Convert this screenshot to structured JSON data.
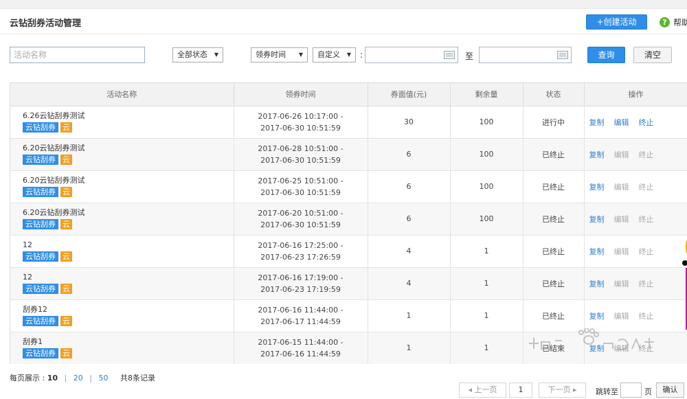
{
  "header": {
    "title": "云钻刮券活动管理",
    "create_label": "+创建活动",
    "help_label": "帮助"
  },
  "filters": {
    "name_placeholder": "活动名称",
    "status_select": "全部状态",
    "time_type_select": "领券时间",
    "range_select": "自定义",
    "colon": ":",
    "to_label": "至",
    "query_label": "查询",
    "clear_label": "清空"
  },
  "table": {
    "columns": [
      "活动名称",
      "领券时间",
      "券面值(元)",
      "剩余量",
      "状态",
      "操作"
    ],
    "tag_primary": "云钻刮券",
    "tag_secondary": "云",
    "rows": [
      {
        "name": "6.26云钻刮券测试",
        "start": "2017-06-26 10:17:00 -",
        "end": "2017-06-30 10:51:59",
        "value": "30",
        "remaining": "100",
        "status": "进行中",
        "ops": [
          "复制",
          "编辑",
          "终止"
        ],
        "ops_enabled": [
          true,
          true,
          true
        ]
      },
      {
        "name": "6.20云钻刮券测试",
        "start": "2017-06-28 10:51:00 -",
        "end": "2017-06-30 10:51:59",
        "value": "6",
        "remaining": "100",
        "status": "已终止",
        "ops": [
          "复制",
          "编辑",
          "终止"
        ],
        "ops_enabled": [
          true,
          false,
          false
        ]
      },
      {
        "name": "6.20云钻刮券测试",
        "start": "2017-06-25 10:51:00 -",
        "end": "2017-06-30 10:51:59",
        "value": "6",
        "remaining": "100",
        "status": "已终止",
        "ops": [
          "复制",
          "编辑",
          "终止"
        ],
        "ops_enabled": [
          true,
          false,
          false
        ]
      },
      {
        "name": "6.20云钻刮券测试",
        "start": "2017-06-20 10:51:00 -",
        "end": "2017-06-30 10:51:59",
        "value": "6",
        "remaining": "100",
        "status": "已终止",
        "ops": [
          "复制",
          "编辑",
          "终止"
        ],
        "ops_enabled": [
          true,
          false,
          false
        ]
      },
      {
        "name": "12",
        "start": "2017-06-16 17:25:00 -",
        "end": "2017-06-23 17:26:59",
        "value": "4",
        "remaining": "1",
        "status": "已终止",
        "ops": [
          "复制",
          "编辑",
          "终止"
        ],
        "ops_enabled": [
          true,
          false,
          false
        ]
      },
      {
        "name": "12",
        "start": "2017-06-16 17:19:00 -",
        "end": "2017-06-23 17:19:59",
        "value": "4",
        "remaining": "1",
        "status": "已终止",
        "ops": [
          "复制",
          "编辑",
          "终止"
        ],
        "ops_enabled": [
          true,
          false,
          false
        ]
      },
      {
        "name": "刮券12",
        "start": "2017-06-16 11:44:00 -",
        "end": "2017-06-17 11:44:59",
        "value": "1",
        "remaining": "1",
        "status": "已终止",
        "ops": [
          "复制",
          "编辑",
          "终止"
        ],
        "ops_enabled": [
          true,
          false,
          false
        ]
      },
      {
        "name": "刮券1",
        "start": "2017-06-15 11:44:00 -",
        "end": "2017-06-16 11:44:59",
        "value": "1",
        "remaining": "1",
        "status": "已结束",
        "ops": [
          "复制",
          "编辑",
          "终止"
        ],
        "ops_enabled": [
          true,
          false,
          false
        ]
      }
    ]
  },
  "footer": {
    "per_page_label": "每页展示 :",
    "per_page_options": [
      "10",
      "20",
      "50"
    ],
    "per_page_sep": "|",
    "total_label": "共8条记录",
    "prev_label": "上一页",
    "current_page": "1",
    "next_label": "下一页",
    "jump_label": "跳转至",
    "page_unit": "页",
    "confirm_label": "确认"
  },
  "colors": {
    "primary": "#2f8ee8",
    "tag_orange": "#f0a023",
    "link": "#2f7fd4",
    "help_green": "#5cb531"
  }
}
